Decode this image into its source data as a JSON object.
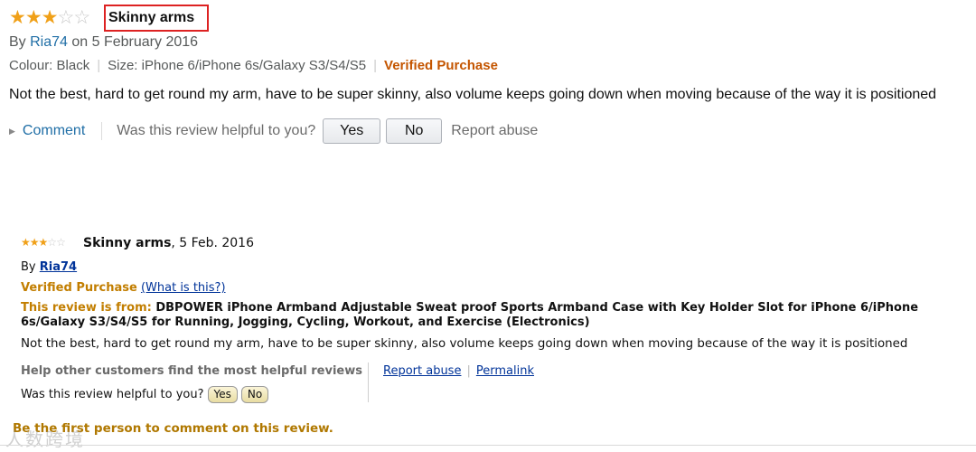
{
  "review_new": {
    "rating": 3,
    "max_rating": 5,
    "title": "Skinny arms",
    "by_prefix": "By",
    "author": "Ria74",
    "on_date": "on 5 February 2016",
    "colour": "Colour: Black",
    "size": "Size: iPhone 6/iPhone 6s/Galaxy S3/S4/S5",
    "verified": "Verified Purchase",
    "body": "Not the best, hard to get round my arm, have to be super skinny, also volume keeps going down when moving because of the way it is positioned",
    "comment_label": "Comment",
    "helpful_question": "Was this review helpful to you?",
    "yes_label": "Yes",
    "no_label": "No",
    "report_label": "Report abuse"
  },
  "review_old": {
    "rating": 3,
    "max_rating": 5,
    "title": "Skinny arms",
    "date": ", 5 Feb. 2016",
    "by_prefix": "By",
    "author": "Ria74",
    "verified": "Verified Purchase",
    "what_is_this": "(What is this?)",
    "from_label": "This review is from:",
    "product": "DBPOWER iPhone Armband Adjustable Sweat proof Sports Armband Case with Key Holder Slot for iPhone 6/iPhone 6s/Galaxy S3/S4/S5 for Running, Jogging, Cycling, Workout, and Exercise (Electronics)",
    "body": "Not the best, hard to get round my arm, have to be super skinny, also volume keeps going down when moving because of the way it is positioned",
    "help_others": "Help other customers find the most helpful reviews",
    "helpful_question": "Was this review helpful to you?",
    "yes_label": "Yes",
    "no_label": "No",
    "report_label": "Report abuse",
    "permalink_label": "Permalink",
    "first_comment": "Be the first person to comment on this review."
  },
  "watermark": "人数跨境",
  "colors": {
    "star": "#f0a018",
    "link_new": "#1f6ea6",
    "verified_new": "#c45500",
    "link_old": "#003399",
    "verified_old": "#c27e00",
    "highlight_box": "#dd2222"
  }
}
